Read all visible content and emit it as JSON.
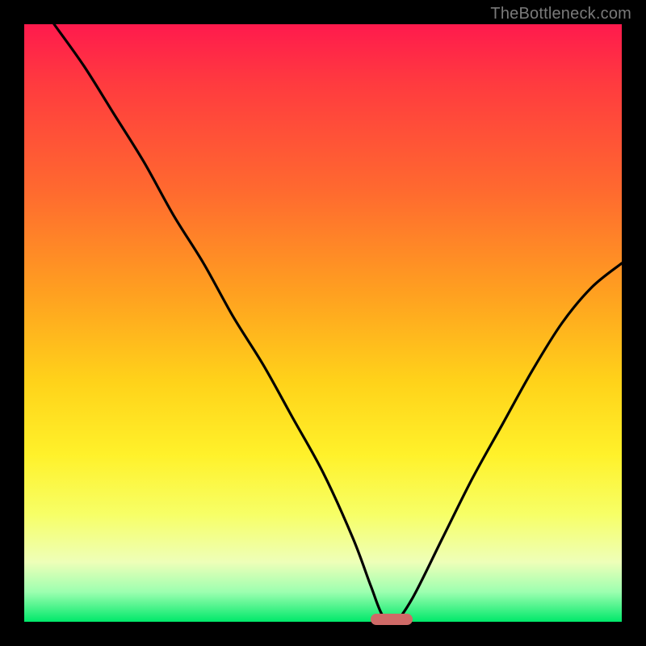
{
  "watermark": "TheBottleneck.com",
  "colors": {
    "frame": "#000000",
    "gradient_top": "#ff1a4d",
    "gradient_bottom": "#00e86a",
    "curve": "#000000",
    "marker": "#cf6a67"
  },
  "chart_data": {
    "type": "line",
    "title": "",
    "xlabel": "",
    "ylabel": "",
    "xlim": [
      0,
      100
    ],
    "ylim": [
      0,
      100
    ],
    "series": [
      {
        "name": "bottleneck-curve",
        "x": [
          5,
          10,
          15,
          20,
          25,
          30,
          35,
          40,
          45,
          50,
          55,
          58,
          60,
          62,
          65,
          70,
          75,
          80,
          85,
          90,
          95,
          100
        ],
        "values": [
          100,
          93,
          85,
          77,
          68,
          60,
          51,
          43,
          34,
          25,
          14,
          6,
          1,
          0,
          4,
          14,
          24,
          33,
          42,
          50,
          56,
          60
        ]
      }
    ],
    "marker": {
      "x_start": 58,
      "x_end": 65,
      "y": 0
    }
  }
}
